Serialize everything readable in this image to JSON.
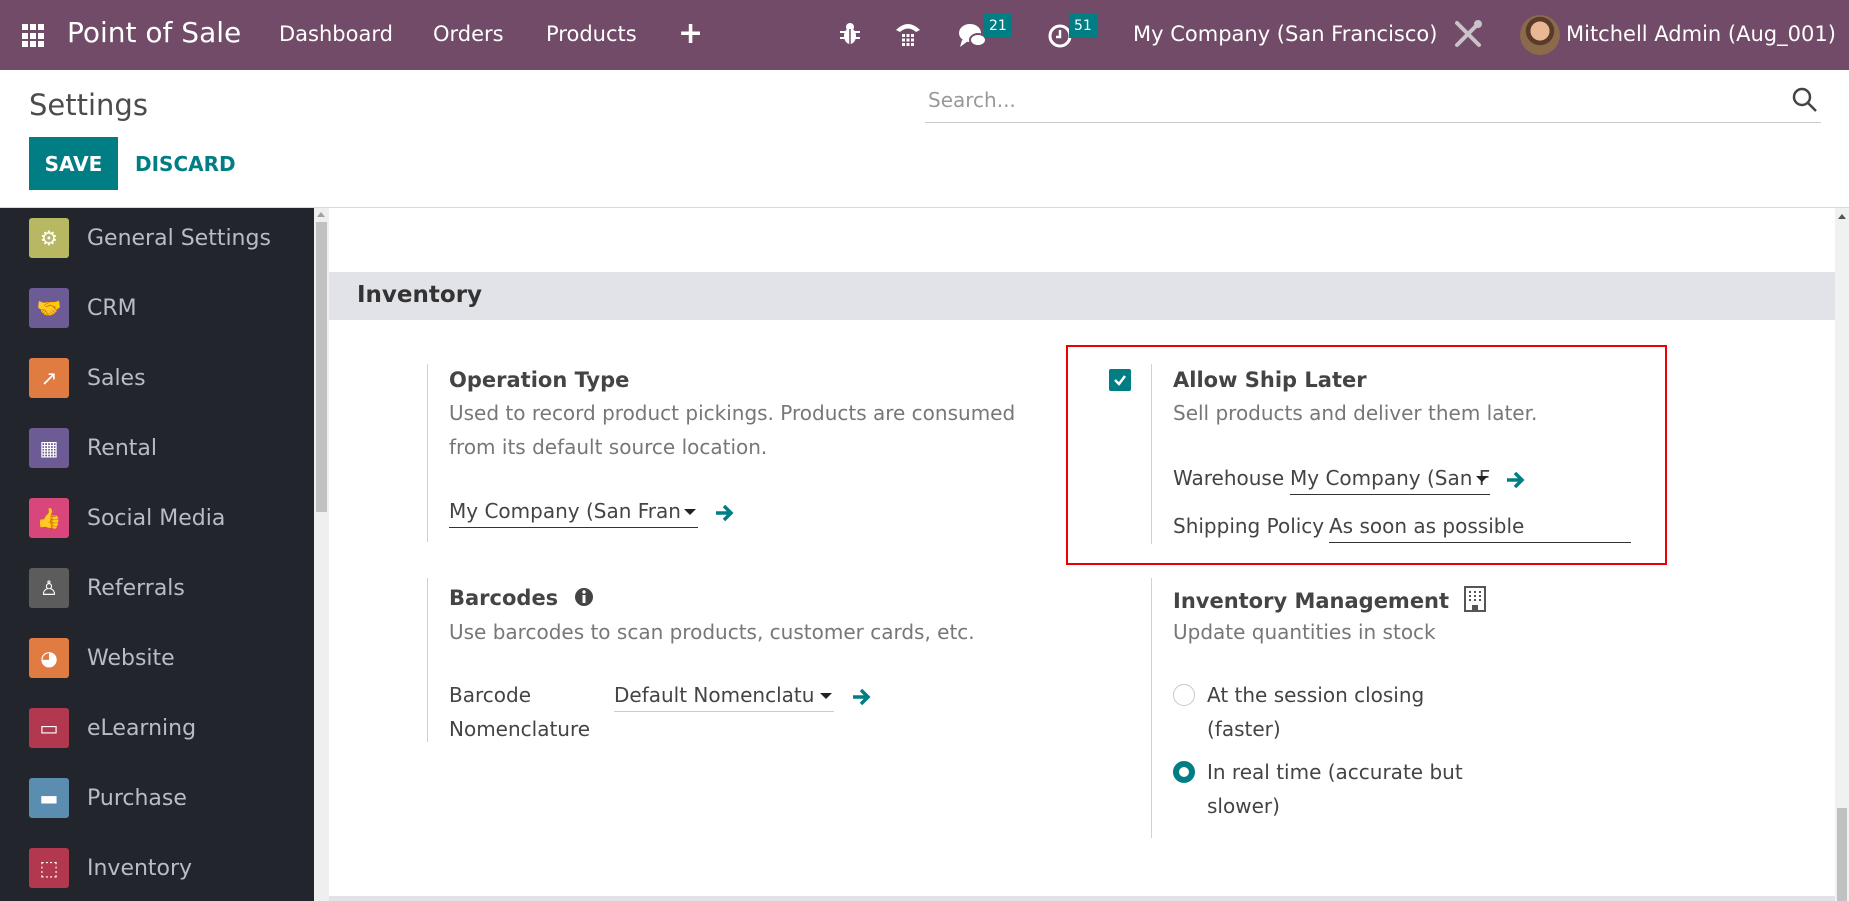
{
  "navbar": {
    "app_name": "Point of Sale",
    "menu": [
      "Dashboard",
      "Orders",
      "Products"
    ],
    "new_icon": "plus-icon",
    "debug_icon": "bug-icon",
    "phone_icon": "phone-icon",
    "messages_icon": "chat-icon",
    "messages_count": "21",
    "activities_icon": "clock-icon",
    "activities_count": "51",
    "company": "My Company (San Francisco)",
    "tools_icon": "tools-icon",
    "user": "Mitchell Admin (Aug_001)"
  },
  "control": {
    "title": "Settings",
    "save_label": "SAVE",
    "discard_label": "DISCARD",
    "search_placeholder": "Search...",
    "search_value": ""
  },
  "sidebar": {
    "items": [
      {
        "label": "General Settings",
        "icon": "gear-icon",
        "color": "#b8b863"
      },
      {
        "label": "CRM",
        "icon": "handshake-icon",
        "color": "#6c5b94"
      },
      {
        "label": "Sales",
        "icon": "chart-up-icon",
        "color": "#e07b42"
      },
      {
        "label": "Rental",
        "icon": "calendar-grid-icon",
        "color": "#6c5b94"
      },
      {
        "label": "Social Media",
        "icon": "thumbs-up-icon",
        "color": "#d9467b"
      },
      {
        "label": "Referrals",
        "icon": "hero-icon",
        "color": "#5c5c5c"
      },
      {
        "label": "Website",
        "icon": "globe-icon",
        "color": "#e07b42"
      },
      {
        "label": "eLearning",
        "icon": "presentation-icon",
        "color": "#b2384f"
      },
      {
        "label": "Purchase",
        "icon": "credit-card-icon",
        "color": "#5b8db0"
      },
      {
        "label": "Inventory",
        "icon": "box-icon",
        "color": "#b2384f"
      }
    ]
  },
  "section": {
    "title": "Inventory",
    "operation_type": {
      "title": "Operation Type",
      "description": "Used to record product pickings. Products are consumed from its default source location.",
      "value": "My Company (San Fran"
    },
    "ship_later": {
      "checked": true,
      "title": "Allow Ship Later",
      "description": "Sell products and deliver them later.",
      "warehouse_label": "Warehouse",
      "warehouse_value": "My Company (San Fran",
      "policy_label": "Shipping Policy",
      "policy_value": "As soon as possible"
    },
    "barcodes": {
      "title": "Barcodes",
      "description": "Use barcodes to scan products, customer cards, etc.",
      "field_label_1": "Barcode",
      "field_label_2": "Nomenclature",
      "value": "Default Nomenclatu"
    },
    "inventory_management": {
      "title": "Inventory Management",
      "description": "Update quantities in stock",
      "options": [
        {
          "label_1": "At the session closing",
          "label_2": "(faster)",
          "selected": false
        },
        {
          "label_1": "In real time (accurate but",
          "label_2": "slower)",
          "selected": true
        }
      ]
    }
  },
  "colors": {
    "brand": "#714b67",
    "accent": "#017e84",
    "highlight": "#ee0000"
  }
}
